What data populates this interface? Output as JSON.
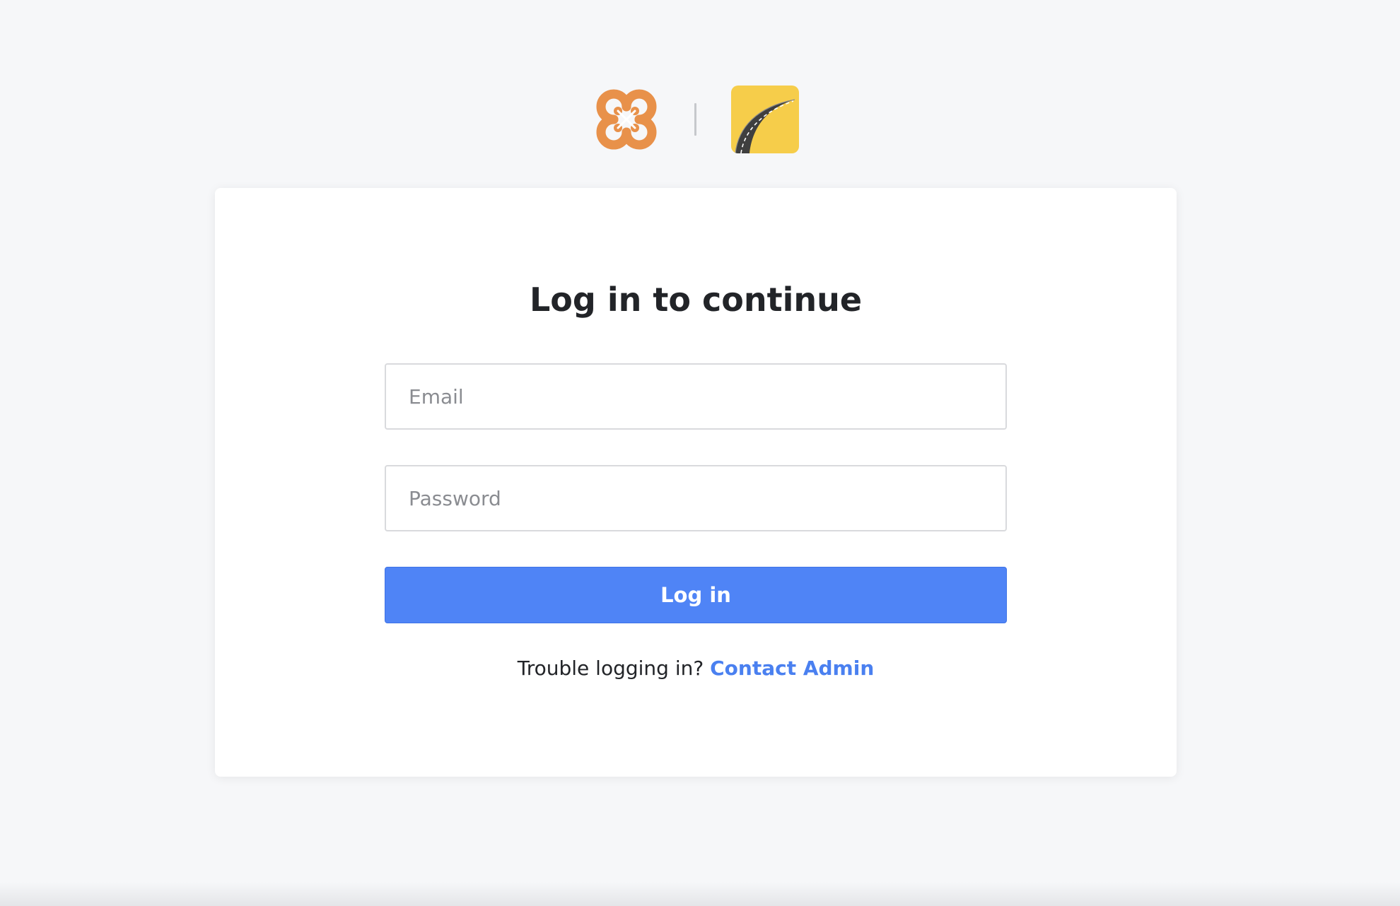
{
  "logos": {
    "left_icon": "orange-quatrefoil-logo",
    "right_icon": "yellow-road-logo",
    "left_color": "#e8914a",
    "right_color": "#f6cd4a"
  },
  "login": {
    "title": "Log in to continue",
    "email_placeholder": "Email",
    "password_placeholder": "Password",
    "submit_label": "Log in",
    "help_text": "Trouble logging in?",
    "help_link": "Contact Admin"
  },
  "colors": {
    "accent": "#4f84f6",
    "link": "#4a80f0",
    "background": "#f6f7f9"
  }
}
